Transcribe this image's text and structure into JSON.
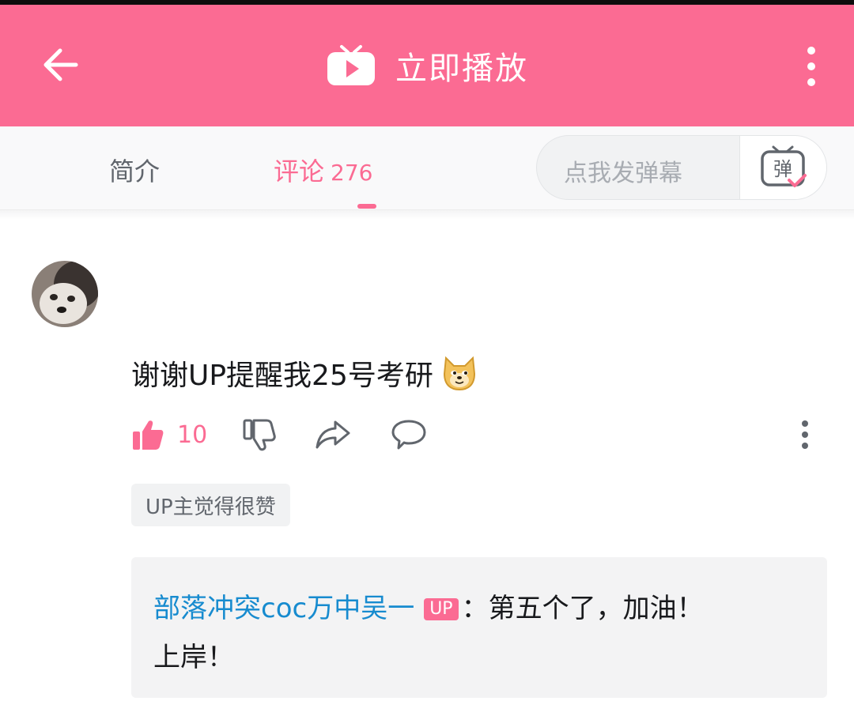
{
  "header": {
    "title": "立即播放",
    "back_icon": "arrow-left-icon",
    "more_icon": "more-vertical-icon",
    "brand_color": "#fb6b93"
  },
  "tabs": {
    "intro_label": "简介",
    "comments_label": "评论",
    "comments_count": "276",
    "active": "comments"
  },
  "danmaku": {
    "placeholder": "点我发弹幕",
    "send_icon_text": "弹"
  },
  "comment": {
    "text": "谢谢UP提醒我25号考研",
    "emoji": "doge-emoji-icon",
    "like_count": "10",
    "up_liked_label": "UP主觉得很赞"
  },
  "reply": {
    "author": "部落冲突coc万中吴一",
    "badge": "UP",
    "separator": "：",
    "text_line1": "第五个了，加油！",
    "text_line2": "上岸！",
    "author_color": "#178bcf"
  }
}
